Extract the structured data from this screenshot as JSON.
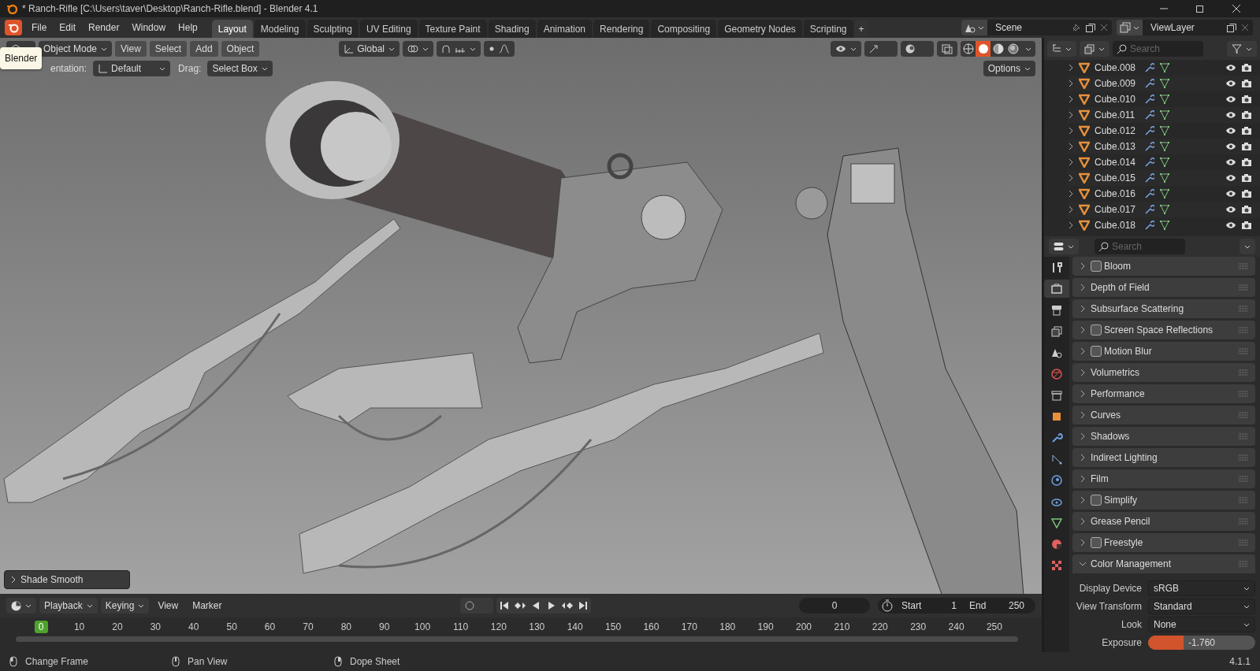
{
  "window": {
    "title": "* Ranch-Rifle [C:\\Users\\taver\\Desktop\\Ranch-Rifle.blend] - Blender 4.1"
  },
  "menu": [
    "File",
    "Edit",
    "Render",
    "Window",
    "Help"
  ],
  "workspace_tabs": [
    {
      "label": "Layout",
      "selected": true
    },
    {
      "label": "Modeling",
      "selected": false
    },
    {
      "label": "Sculpting",
      "selected": false
    },
    {
      "label": "UV Editing",
      "selected": false
    },
    {
      "label": "Texture Paint",
      "selected": false
    },
    {
      "label": "Shading",
      "selected": false
    },
    {
      "label": "Animation",
      "selected": false
    },
    {
      "label": "Rendering",
      "selected": false
    },
    {
      "label": "Compositing",
      "selected": false
    },
    {
      "label": "Geometry Nodes",
      "selected": false
    },
    {
      "label": "Scripting",
      "selected": false
    }
  ],
  "add_tab": "+",
  "scene": "Scene",
  "view_layer": "ViewLayer",
  "viewport": {
    "mode": "Object Mode",
    "menus": [
      "View",
      "Select",
      "Add",
      "Object"
    ],
    "transform": "Global",
    "orientation_label": "entation:",
    "orientation": "Default",
    "drag_label": "Drag:",
    "drag": "Select Box",
    "options": "Options",
    "tooltip": "Blender",
    "last_operator": "Shade Smooth",
    "shading_modes": [
      {
        "kind": "wireframe",
        "selected": false
      },
      {
        "kind": "solid",
        "selected": true
      },
      {
        "kind": "material",
        "selected": false
      },
      {
        "kind": "rendered",
        "selected": false
      }
    ]
  },
  "outliner": {
    "search": {
      "placeholder": "Search"
    },
    "rows": [
      {
        "name": "Cube.008"
      },
      {
        "name": "Cube.009"
      },
      {
        "name": "Cube.010"
      },
      {
        "name": "Cube.011"
      },
      {
        "name": "Cube.012"
      },
      {
        "name": "Cube.013"
      },
      {
        "name": "Cube.014"
      },
      {
        "name": "Cube.015"
      },
      {
        "name": "Cube.016"
      },
      {
        "name": "Cube.017"
      },
      {
        "name": "Cube.018"
      }
    ]
  },
  "properties": {
    "search": {
      "placeholder": "Search"
    },
    "tabs": [
      {
        "kind": "tool",
        "selected": false
      },
      {
        "kind": "render",
        "selected": true
      },
      {
        "kind": "output",
        "selected": false
      },
      {
        "kind": "view_layer",
        "selected": false
      },
      {
        "kind": "scene",
        "selected": false
      },
      {
        "kind": "world",
        "selected": false
      },
      {
        "kind": "collection",
        "selected": false
      },
      {
        "kind": "object",
        "selected": false
      },
      {
        "kind": "modifier",
        "selected": false
      },
      {
        "kind": "particles",
        "selected": false
      },
      {
        "kind": "physics",
        "selected": false
      },
      {
        "kind": "constraint",
        "selected": false
      },
      {
        "kind": "data",
        "selected": false
      },
      {
        "kind": "material",
        "selected": false
      },
      {
        "kind": "texture",
        "selected": false
      }
    ],
    "panels": [
      {
        "label": "Bloom",
        "kind": "checkbox",
        "checked": false,
        "expanded": false
      },
      {
        "label": "Depth of Field",
        "kind": "plain",
        "expanded": false
      },
      {
        "label": "Subsurface Scattering",
        "kind": "plain",
        "expanded": false
      },
      {
        "label": "Screen Space Reflections",
        "kind": "checkbox",
        "checked": false,
        "expanded": false
      },
      {
        "label": "Motion Blur",
        "kind": "checkbox",
        "checked": false,
        "expanded": false
      },
      {
        "label": "Volumetrics",
        "kind": "plain",
        "expanded": false
      },
      {
        "label": "Performance",
        "kind": "plain",
        "expanded": false
      },
      {
        "label": "Curves",
        "kind": "plain",
        "expanded": false
      },
      {
        "label": "Shadows",
        "kind": "plain",
        "expanded": false
      },
      {
        "label": "Indirect Lighting",
        "kind": "plain",
        "expanded": false
      },
      {
        "label": "Film",
        "kind": "plain",
        "expanded": false
      },
      {
        "label": "Simplify",
        "kind": "checkbox",
        "checked": false,
        "expanded": false
      },
      {
        "label": "Grease Pencil",
        "kind": "plain",
        "expanded": false
      },
      {
        "label": "Freestyle",
        "kind": "checkbox",
        "checked": false,
        "expanded": false
      },
      {
        "label": "Color Management",
        "kind": "plain",
        "expanded": true
      }
    ],
    "fields": [
      {
        "label": "Display Device",
        "kind": "dropdown",
        "value": "sRGB"
      },
      {
        "label": "View Transform",
        "kind": "dropdown",
        "value": "Standard"
      },
      {
        "label": "Look",
        "kind": "dropdown",
        "value": "None"
      },
      {
        "label": "Exposure",
        "kind": "slider",
        "value": "-1.760",
        "level": 0.33
      }
    ]
  },
  "timeline": {
    "menus": [
      "Playback",
      "Keying"
    ],
    "menu_links": [
      "View",
      "Marker"
    ],
    "current_frame": "0",
    "start_label": "Start",
    "start": "1",
    "end_label": "End",
    "end": "250",
    "ticks": [
      {
        "label": "0",
        "selected": true
      },
      {
        "label": "10",
        "selected": false
      },
      {
        "label": "20",
        "selected": false
      },
      {
        "label": "30",
        "selected": false
      },
      {
        "label": "40",
        "selected": false
      },
      {
        "label": "50",
        "selected": false
      },
      {
        "label": "60",
        "selected": false
      },
      {
        "label": "70",
        "selected": false
      },
      {
        "label": "80",
        "selected": false
      },
      {
        "label": "90",
        "selected": false
      },
      {
        "label": "100",
        "selected": false
      },
      {
        "label": "110",
        "selected": false
      },
      {
        "label": "120",
        "selected": false
      },
      {
        "label": "130",
        "selected": false
      },
      {
        "label": "140",
        "selected": false
      },
      {
        "label": "150",
        "selected": false
      },
      {
        "label": "160",
        "selected": false
      },
      {
        "label": "170",
        "selected": false
      },
      {
        "label": "180",
        "selected": false
      },
      {
        "label": "190",
        "selected": false
      },
      {
        "label": "200",
        "selected": false
      },
      {
        "label": "210",
        "selected": false
      },
      {
        "label": "220",
        "selected": false
      },
      {
        "label": "230",
        "selected": false
      },
      {
        "label": "240",
        "selected": false
      },
      {
        "label": "250",
        "selected": false
      }
    ]
  },
  "status_bar": {
    "hints": [
      "Change Frame",
      "Pan View",
      "Dope Sheet"
    ],
    "version": "4.1.1"
  }
}
